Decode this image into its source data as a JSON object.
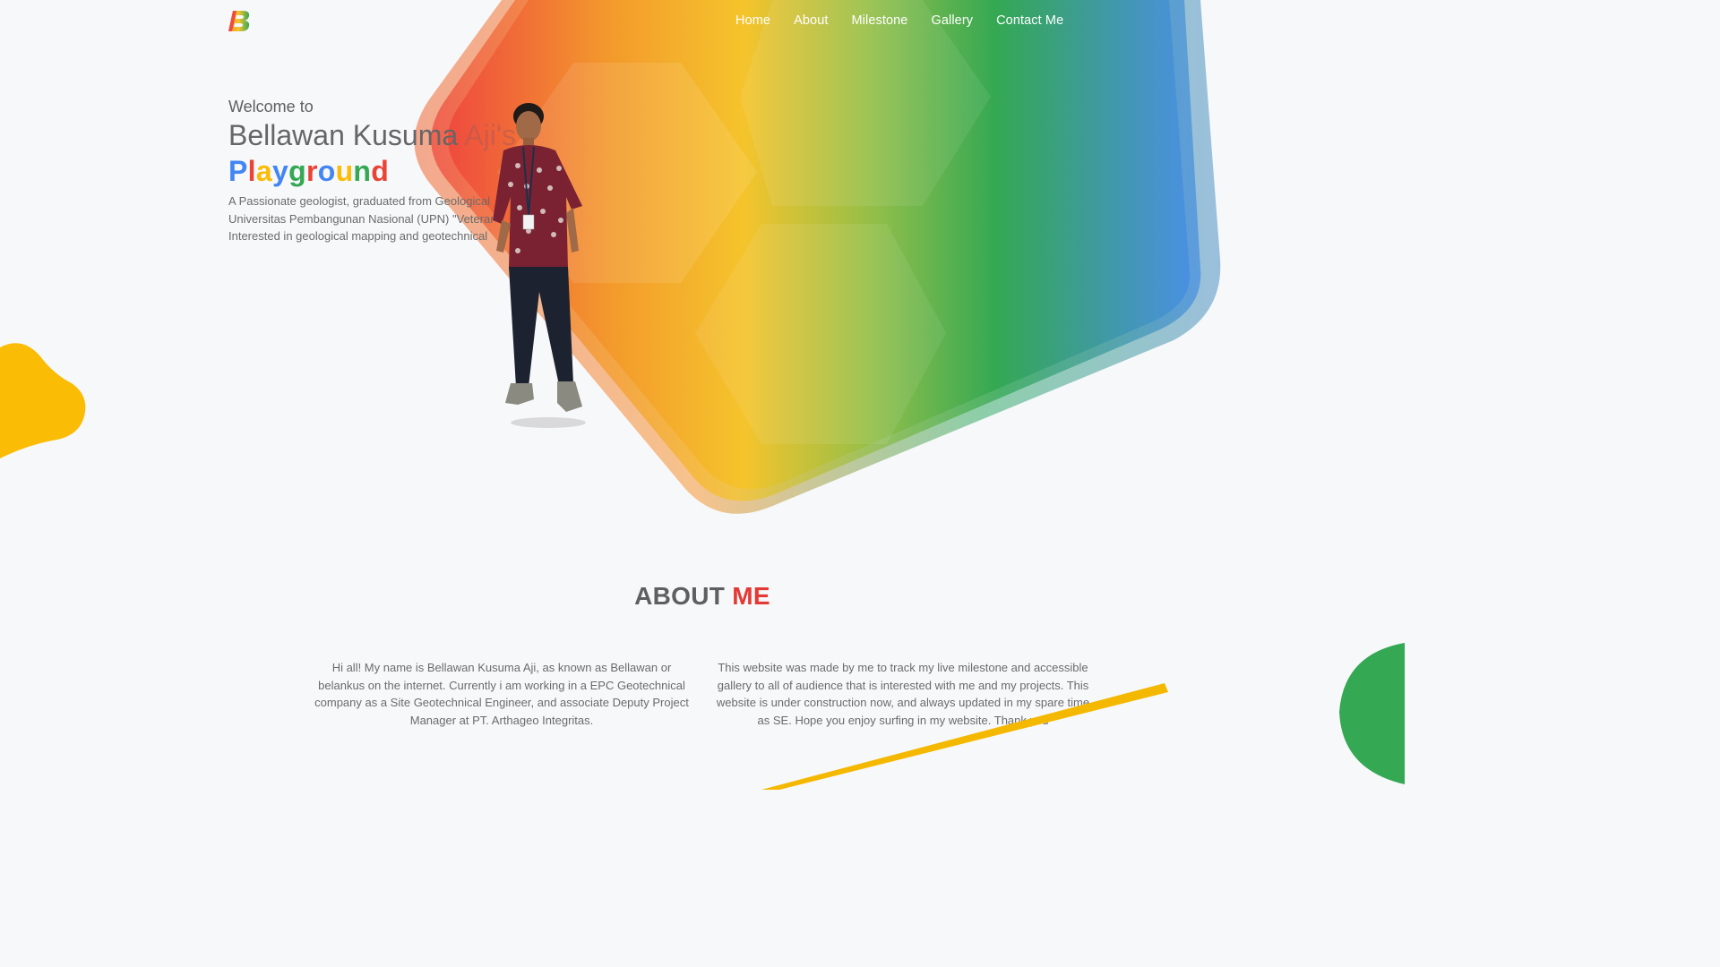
{
  "brand": {
    "logo_letter": "B"
  },
  "nav": {
    "items": [
      {
        "label": "Home"
      },
      {
        "label": "About"
      },
      {
        "label": "Milestone"
      },
      {
        "label": "Gallery"
      },
      {
        "label": "Contact Me"
      }
    ]
  },
  "hero": {
    "welcome": "Welcome to",
    "name_main": "Bellawan Kusuma",
    "name_faded": " Aji's",
    "playground_letters": [
      {
        "char": "P",
        "color": "#4285f4"
      },
      {
        "char": "l",
        "color": "#ea4335"
      },
      {
        "char": "a",
        "color": "#fbbc05"
      },
      {
        "char": "y",
        "color": "#4285f4"
      },
      {
        "char": "g",
        "color": "#34a853"
      },
      {
        "char": "r",
        "color": "#ea4335"
      },
      {
        "char": "o",
        "color": "#4285f4"
      },
      {
        "char": "u",
        "color": "#fbbc05"
      },
      {
        "char": "n",
        "color": "#34a853"
      },
      {
        "char": "d",
        "color": "#ea4335"
      }
    ],
    "desc_line1": "A Passionate geologist, graduated from Geological",
    "desc_line2": "Universitas Pembangunan Nasional (UPN) \"Veteran",
    "desc_line3": "Interested in geological mapping and geotechnical"
  },
  "about": {
    "title_main": "ABOUT",
    "title_accent": "ME",
    "left_text": "Hi all! My name is Bellawan Kusuma Aji, as known as Bellawan or belankus on the internet. Currently i am working in a EPC Geotechnical company as a Site Geotechnical Engineer, and associate Deputy Project Manager at PT. Arthageo Integritas.",
    "right_text": "This website was made by me to track my live milestone and accessible gallery to all of audience that is interested with me and my projects. This website is under construction now, and always updated in my spare time as SE. Hope you enjoy surfing in my website. Thank you"
  },
  "colors": {
    "accent_red": "#e53935",
    "blob_yellow": "#fbbc05",
    "blob_green": "#34a853",
    "stripe_yellow": "#f5b800"
  }
}
